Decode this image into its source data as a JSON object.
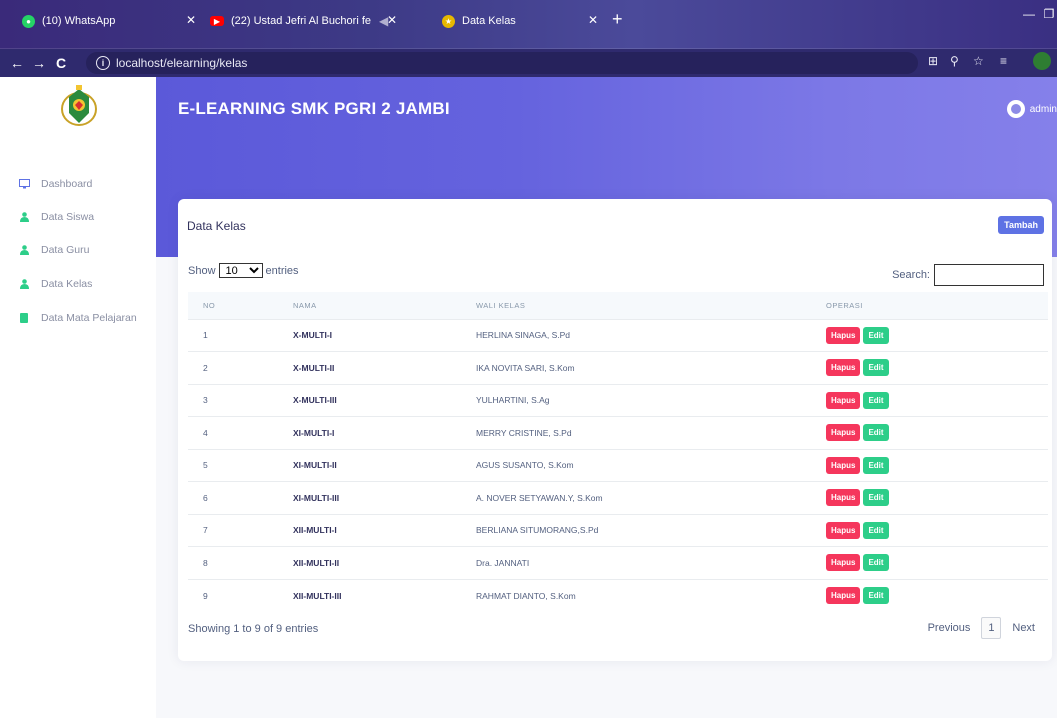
{
  "browser": {
    "tabs": [
      {
        "title": "(10) WhatsApp"
      },
      {
        "title": "(22) Ustad Jefri Al Buchori fe"
      },
      {
        "title": "Data Kelas"
      }
    ],
    "url": "localhost/elearning/kelas"
  },
  "app": {
    "brand": "E-LEARNING SMK PGRI 2 JAMBI",
    "user": "admin"
  },
  "sidebar": {
    "items": [
      {
        "label": "Dashboard",
        "icon": "monitor-icon"
      },
      {
        "label": "Data Siswa",
        "icon": "user-icon"
      },
      {
        "label": "Data Guru",
        "icon": "user-icon"
      },
      {
        "label": "Data Kelas",
        "icon": "user-icon"
      },
      {
        "label": "Data Mata Pelajaran",
        "icon": "book-icon"
      }
    ]
  },
  "card": {
    "title": "Data Kelas",
    "add_label": "Tambah",
    "show_label": "Show",
    "entries_label": "entries",
    "page_length": "10",
    "search_label": "Search:",
    "columns": [
      "NO",
      "NAMA",
      "WALI KELAS",
      "OPERASI"
    ],
    "rows": [
      {
        "no": "1",
        "nama": "X-MULTI-I",
        "wali": "HERLINA SINAGA, S.Pd"
      },
      {
        "no": "2",
        "nama": "X-MULTI-II",
        "wali": "IKA NOVITA SARI, S.Kom"
      },
      {
        "no": "3",
        "nama": "X-MULTI-III",
        "wali": "YULHARTINI, S.Ag"
      },
      {
        "no": "4",
        "nama": "XI-MULTI-I",
        "wali": "MERRY CRISTINE, S.Pd"
      },
      {
        "no": "5",
        "nama": "XI-MULTI-II",
        "wali": "AGUS SUSANTO, S.Kom"
      },
      {
        "no": "6",
        "nama": "XI-MULTI-III",
        "wali": "A. NOVER SETYAWAN.Y, S.Kom"
      },
      {
        "no": "7",
        "nama": "XII-MULTI-I",
        "wali": "BERLIANA SITUMORANG,S.Pd"
      },
      {
        "no": "8",
        "nama": "XII-MULTI-II",
        "wali": "Dra. JANNATI"
      },
      {
        "no": "9",
        "nama": "XII-MULTI-III",
        "wali": "RAHMAT DIANTO, S.Kom"
      }
    ],
    "delete_label": "Hapus",
    "edit_label": "Edit",
    "info": "Showing 1 to 9 of 9 entries",
    "prev_label": "Previous",
    "page": "1",
    "next_label": "Next"
  },
  "colors": {
    "primary": "#5e72e4",
    "danger": "#f5365c",
    "success": "#2dce89",
    "header": "#5b59d9"
  }
}
